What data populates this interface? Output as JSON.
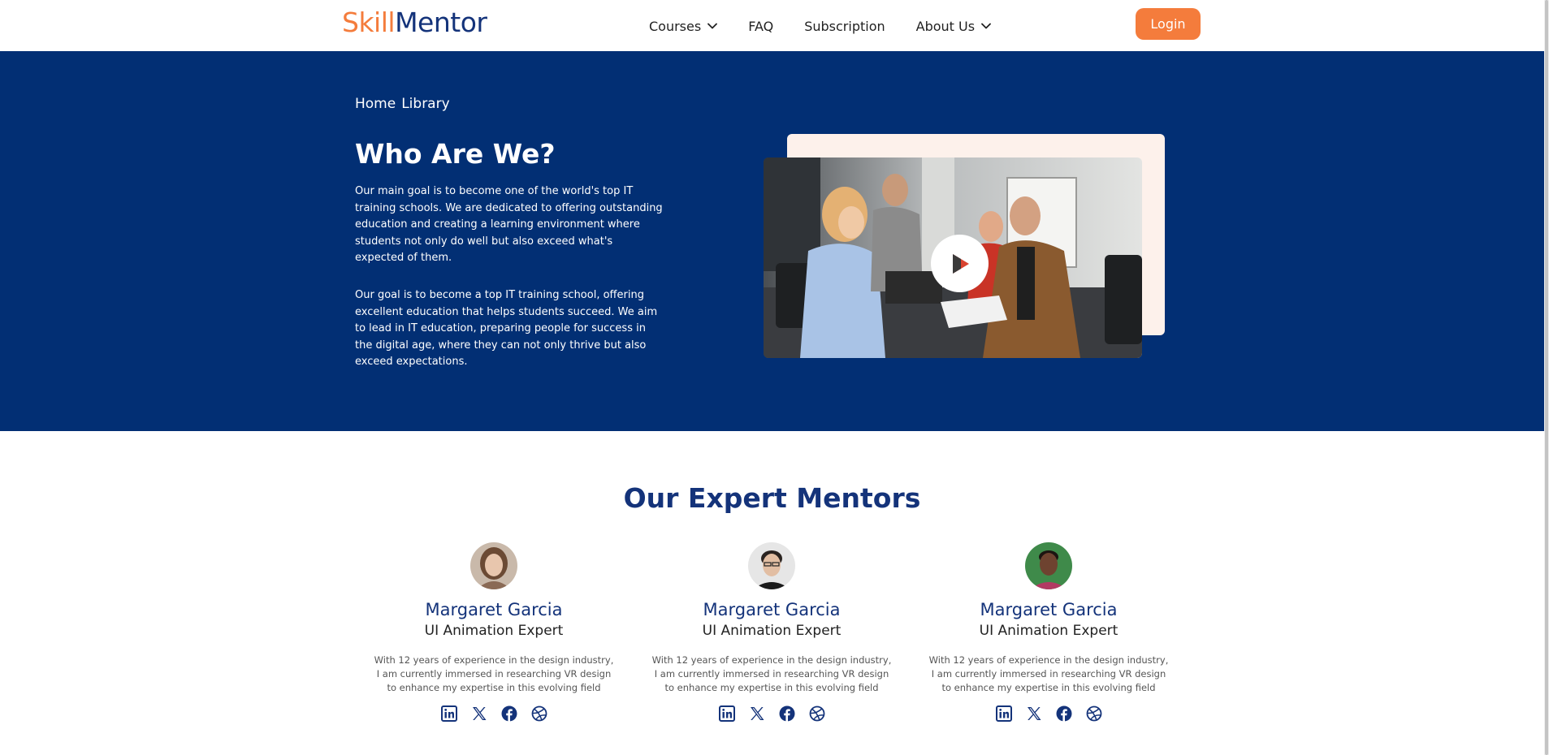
{
  "header": {
    "logo_part1": "Skill",
    "logo_part2": "Mentor",
    "nav": {
      "courses": "Courses",
      "faq": "FAQ",
      "subscription": "Subscription",
      "about": "About Us"
    },
    "login_label": "Login"
  },
  "hero": {
    "breadcrumb": [
      "Home",
      "Library"
    ],
    "title": "Who Are We?",
    "paragraph1": " Our main goal is to become one of the world's top IT training schools. We are dedicated to offering outstanding education and creating a learning environment where students not only do well but also exceed what's expected of them.",
    "paragraph2": "Our goal is to become a top IT training school, offering excellent education that helps students succeed. We aim to lead in IT education, preparing people for success in the digital age, where they can not only thrive but also exceed expectations."
  },
  "mentors_section": {
    "title": "Our Expert Mentors",
    "mentors": [
      {
        "name": "Margaret Garcia",
        "role": "UI Animation Expert",
        "bio": "With 12 years of experience in the design industry, I am currently immersed in researching VR design to enhance my expertise in this evolving field",
        "socials": [
          "linkedin-icon",
          "x-icon",
          "facebook-icon",
          "dribbble-icon"
        ]
      },
      {
        "name": "Margaret Garcia",
        "role": "UI Animation Expert",
        "bio": "With 12 years of experience in the design industry, I am currently immersed in researching VR design to enhance my expertise in this evolving field",
        "socials": [
          "linkedin-icon",
          "x-icon",
          "facebook-icon",
          "dribbble-icon"
        ]
      },
      {
        "name": "Margaret Garcia",
        "role": "UI Animation Expert",
        "bio": "With 12 years of experience in the design industry, I am currently immersed in researching VR design to enhance my expertise in this evolving field",
        "socials": [
          "linkedin-icon",
          "x-icon",
          "facebook-icon",
          "dribbble-icon"
        ]
      }
    ]
  },
  "colors": {
    "brand_orange": "#f47c3c",
    "brand_navy": "#14337a",
    "hero_bg": "#022f74",
    "accent_card": "#fdf1eb"
  }
}
